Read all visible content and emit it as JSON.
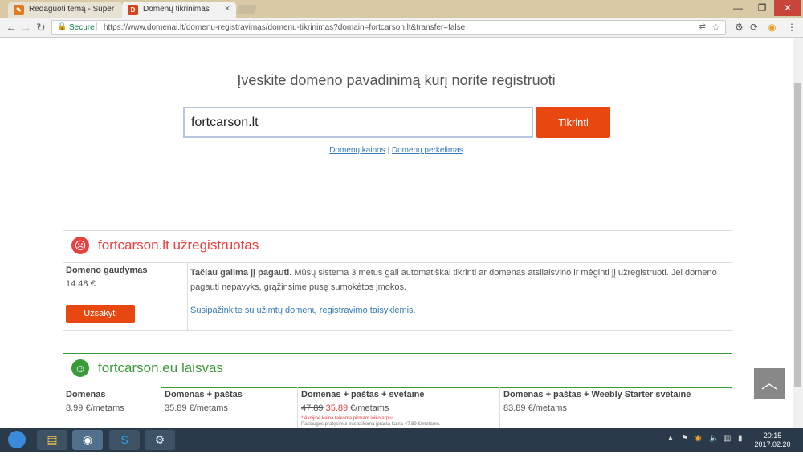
{
  "browser": {
    "tabs": [
      {
        "label": "Redaguoti temą - Super",
        "favicon_color": "#e07a1e",
        "active": false
      },
      {
        "label": "Domenų tikrinimas",
        "favicon_color": "#d9431a",
        "active": true
      }
    ],
    "secure_label": "Secure",
    "url": "https://www.domenai.lt/domenu-registravimas/domenu-tikrinimas?domain=fortcarson.lt&transfer=false"
  },
  "page": {
    "heading": "Įveskite domeno pavadinimą kurį norite registruoti",
    "search_value": "fortcarson.lt",
    "check_button": "Tikrinti",
    "link_prices": "Domenų kainos",
    "link_separator": "|",
    "link_transfer": "Domenų perkelimas"
  },
  "taken": {
    "title": "fortcarson.lt užregistruotas",
    "catch_label": "Domeno gaudymas",
    "catch_price": "14.48 €",
    "order_button": "Užsakyti",
    "desc_bold": "Tačiau galima jį pagauti.",
    "desc_text": " Mūsų sistema 3 metus gali automatiškai tikrinti ar domenas atsilaisvino ir mėginti jį užregistruoti. Jei domeno pagauti nepavyks, grąžinsime pusę sumokėtos įmokos.",
    "rules_link": "Susipažinkite su užimtų domenų registravimo taisyklėmis."
  },
  "free": {
    "title": "fortcarson.eu laisvas",
    "plans": [
      {
        "name": "Domenas",
        "price": "8.99 €/metams"
      },
      {
        "name": "Domenas + paštas",
        "price": "35.89 €/metams"
      },
      {
        "name": "Domenas + paštas + svetainė",
        "old_price": "47.89",
        "new_price": "35.89",
        "price_suffix": " €/metams",
        "note1": "* Akcijinė kaina taikoma pirmam laikotarpiui.",
        "note2": "Paslaugos pratęsimui bus taikoma įprasta kaina 47.89 €/metams."
      },
      {
        "name": "Domenas + paštas + Weebly Starter svetainė",
        "price": "83.89 €/metams"
      }
    ]
  },
  "colors": {
    "accent": "#e8470f",
    "taken": "#e84040",
    "free": "#3a9a3a"
  },
  "taskbar": {
    "time": "20:15",
    "date": "2017.02.20"
  }
}
